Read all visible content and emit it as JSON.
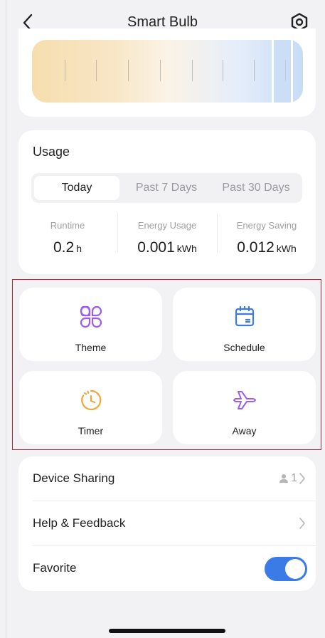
{
  "header": {
    "title": "Smart Bulb",
    "back_icon": "chevron-left-icon",
    "settings_icon": "hexagon-settings-icon"
  },
  "usage": {
    "title": "Usage",
    "tabs": [
      {
        "label": "Today",
        "active": true
      },
      {
        "label": "Past 7 Days",
        "active": false
      },
      {
        "label": "Past 30 Days",
        "active": false
      }
    ],
    "stats": [
      {
        "label": "Runtime",
        "value": "0.2",
        "unit": "h"
      },
      {
        "label": "Energy Usage",
        "value": "0.001",
        "unit": "kWh"
      },
      {
        "label": "Energy Saving",
        "value": "0.012",
        "unit": "kWh"
      }
    ]
  },
  "tiles": [
    {
      "label": "Theme",
      "icon": "theme-grid-icon",
      "color": "#9b5cf0"
    },
    {
      "label": "Schedule",
      "icon": "calendar-icon",
      "color": "#3a7be6"
    },
    {
      "label": "Timer",
      "icon": "clock-icon",
      "color": "#f0a63a"
    },
    {
      "label": "Away",
      "icon": "airplane-icon",
      "color": "#9b5cf0"
    }
  ],
  "list": {
    "device_sharing": {
      "label": "Device Sharing",
      "count": "1"
    },
    "help": {
      "label": "Help & Feedback"
    },
    "favorite": {
      "label": "Favorite",
      "enabled": true
    }
  },
  "colors": {
    "accent": "#3a7be6",
    "highlight": "#c8213a"
  }
}
